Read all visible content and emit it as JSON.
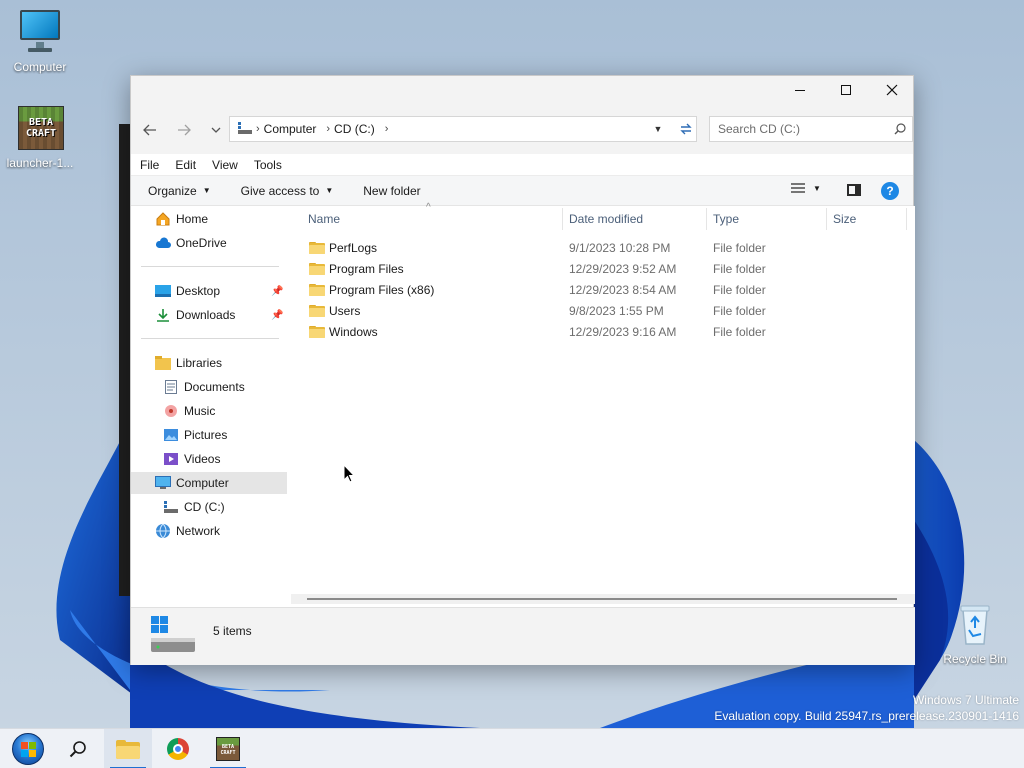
{
  "desktop": {
    "icons": {
      "computer": "Computer",
      "launcher": "launcher-1...",
      "recycle_bin": "Recycle Bin"
    },
    "launcher_badge": "BETA CRAFT",
    "watermark": {
      "line1": "Windows 7 Ultimate",
      "line2": "Evaluation copy. Build 25947.rs_prerelease.230901-1416"
    }
  },
  "explorer": {
    "address": {
      "crumbs": [
        "Computer",
        "CD (C:)"
      ]
    },
    "search": {
      "placeholder": "Search CD (C:)"
    },
    "menu": [
      "File",
      "Edit",
      "View",
      "Tools"
    ],
    "commands": {
      "organize": "Organize",
      "give_access": "Give access to",
      "new_folder": "New folder",
      "help": "?"
    },
    "nav": {
      "home": "Home",
      "onedrive": "OneDrive",
      "desktop": "Desktop",
      "downloads": "Downloads",
      "libraries": "Libraries",
      "documents": "Documents",
      "music": "Music",
      "pictures": "Pictures",
      "videos": "Videos",
      "computer": "Computer",
      "cd_c": "CD (C:)",
      "network": "Network"
    },
    "columns": {
      "name": "Name",
      "date": "Date modified",
      "type": "Type",
      "size": "Size"
    },
    "files": [
      {
        "name": "PerfLogs",
        "date": "9/1/2023 10:28 PM",
        "type": "File folder"
      },
      {
        "name": "Program Files",
        "date": "12/29/2023 9:52 AM",
        "type": "File folder"
      },
      {
        "name": "Program Files (x86)",
        "date": "12/29/2023 8:54 AM",
        "type": "File folder"
      },
      {
        "name": "Users",
        "date": "9/8/2023 1:55 PM",
        "type": "File folder"
      },
      {
        "name": "Windows",
        "date": "12/29/2023 9:16 AM",
        "type": "File folder"
      }
    ],
    "status": {
      "item_count": "5 items"
    }
  },
  "taskbar": {
    "apps": [
      "start",
      "search",
      "file-explorer",
      "chrome",
      "betacraft-launcher"
    ]
  },
  "colors": {
    "accent": "#1f6fd1",
    "folder": "#f8d775",
    "selected_bg": "#e5e5e5"
  }
}
